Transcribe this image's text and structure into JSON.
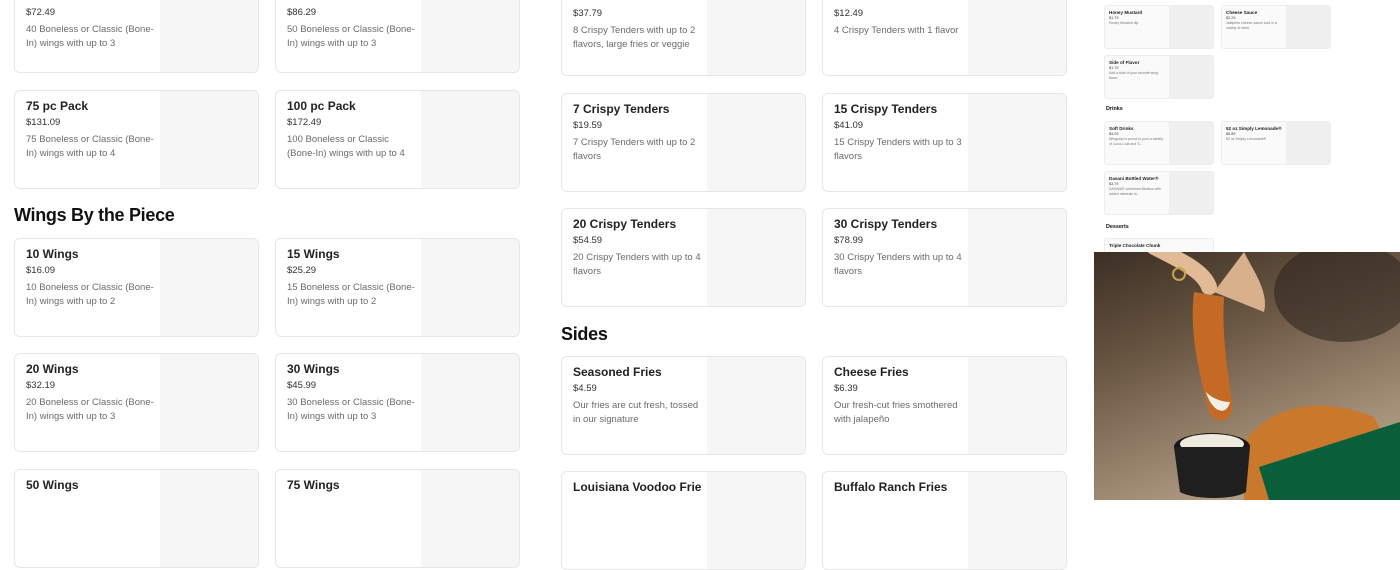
{
  "left_top_cards": [
    {
      "name": "",
      "price": "$72.49",
      "desc": "40 Boneless or Classic (Bone-In) wings with up to 3"
    },
    {
      "name": "",
      "price": "$86.29",
      "desc": "50 Boneless or Classic (Bone-In) wings with up to 3"
    }
  ],
  "left_packs": [
    {
      "name": "75 pc Pack",
      "price": "$131.09",
      "desc": "75 Boneless or Classic (Bone-In) wings with up to 4"
    },
    {
      "name": "100 pc Pack",
      "price": "$172.49",
      "desc": "100 Boneless or Classic (Bone-In) wings with up to 4"
    }
  ],
  "wings_by_piece": {
    "title": "Wings By the Piece",
    "items": [
      {
        "name": "10 Wings",
        "price": "$16.09",
        "desc": "10 Boneless or Classic (Bone-In) wings with up to 2"
      },
      {
        "name": "15 Wings",
        "price": "$25.29",
        "desc": "15 Boneless or Classic (Bone-In) wings with up to 2"
      },
      {
        "name": "20 Wings",
        "price": "$32.19",
        "desc": "20 Boneless or Classic (Bone-In) wings with up to 3"
      },
      {
        "name": "30 Wings",
        "price": "$45.99",
        "desc": "30 Boneless or Classic (Bone-In) wings with up to 3"
      },
      {
        "name": "50 Wings",
        "price": "",
        "desc": ""
      },
      {
        "name": "75 Wings",
        "price": "",
        "desc": ""
      }
    ]
  },
  "tenders": [
    {
      "name": "",
      "price": "$37.79",
      "desc": "8 Crispy Tenders with up to 2 flavors, large fries or veggie"
    },
    {
      "name": "",
      "price": "$12.49",
      "desc": "4 Crispy Tenders with 1 flavor"
    },
    {
      "name": "7 Crispy Tenders",
      "price": "$19.59",
      "desc": "7 Crispy Tenders with up to 2 flavors"
    },
    {
      "name": "15 Crispy Tenders",
      "price": "$41.09",
      "desc": "15 Crispy Tenders with up to 3 flavors"
    },
    {
      "name": "20 Crispy Tenders",
      "price": "$54.59",
      "desc": "20 Crispy Tenders with up to 4 flavors"
    },
    {
      "name": "30 Crispy Tenders",
      "price": "$78.99",
      "desc": "30 Crispy Tenders with up to 4 flavors"
    }
  ],
  "sides": {
    "title": "Sides",
    "items": [
      {
        "name": "Seasoned Fries",
        "price": "$4.59",
        "desc": "Our fries are cut fresh, tossed in our signature"
      },
      {
        "name": "Cheese Fries",
        "price": "$6.39",
        "desc": "Our fresh-cut fries smothered with jalapeño"
      },
      {
        "name": "Louisiana Voodoo Fries",
        "price": "",
        "desc": ""
      },
      {
        "name": "Buffalo Ranch Fries",
        "price": "",
        "desc": ""
      }
    ]
  },
  "mini_menu": {
    "cards": [
      {
        "name": "Honey Mustard",
        "price": "$1.79",
        "desc": "Honey Mustard dip"
      },
      {
        "name": "Cheese Sauce",
        "price": "$2.29",
        "desc": "Jalapeño cheese sauce sold in a variety of sizes"
      },
      {
        "name": "Side of Flavor",
        "price": "$1.79",
        "desc": "Add a side of your favorite wing flavor"
      }
    ],
    "drinks_heading": "Drinks",
    "drinks": [
      {
        "name": "Soft Drinks",
        "price": "$4.09",
        "desc": "Wingstop is proud to pour a variety of Coca-Cola and S..."
      },
      {
        "name": "52 oz Simply Lemonade®",
        "price": "$6.89",
        "desc": "52 oz Simply Lemonade®"
      },
      {
        "name": "Dasani Bottled Water®",
        "price": "$3.79",
        "desc": "DASANI® combines filtration with added minerals fo..."
      }
    ],
    "desserts_heading": "Desserts",
    "dessert_item": "Triple Chocolate Chunk"
  },
  "colors": {
    "brand_green": "#0b5e3a",
    "card_border": "#e6e6e6",
    "thumb_bg": "#f6f6f6"
  }
}
